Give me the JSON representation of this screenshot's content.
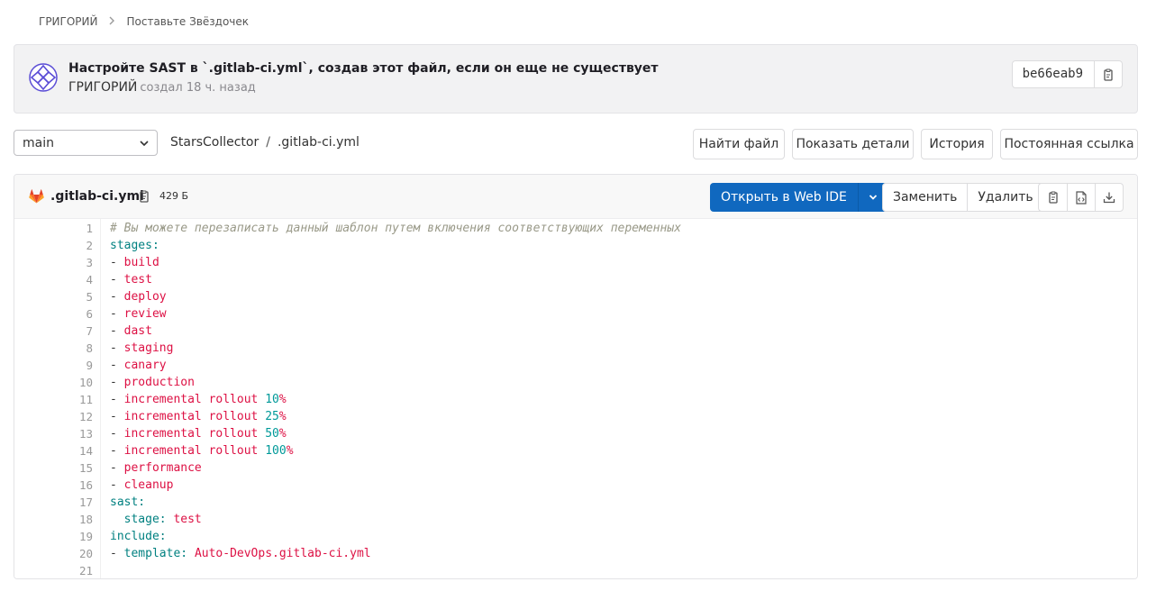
{
  "breadcrumb": {
    "items": [
      "ГРИГОРИЙ",
      "Поставьте Звёздочек"
    ]
  },
  "commit": {
    "title": "Настройте SAST в `.gitlab-ci.yml`, создав этот файл, если он еще не существует",
    "author": "ГРИГОРИЙ",
    "time": "создал 18 ч. назад",
    "sha": "be66eab9"
  },
  "toolbar": {
    "branch": "main",
    "project": "StarsCollector",
    "separator": "/",
    "file_path": ".gitlab-ci.yml",
    "find_file": "Найти файл",
    "show_details": "Показать детали",
    "history": "История",
    "permalink": "Постоянная ссылка"
  },
  "file": {
    "name": ".gitlab-ci.yml",
    "size": "429 Б",
    "open_web_ide": "Открыть в Web IDE",
    "replace": "Заменить",
    "delete": "Удалить"
  },
  "code_lines": [
    [
      [
        "c",
        "# Вы можете перезаписать данный шаблон путем включения соответствующих переменных"
      ]
    ],
    [
      [
        "k",
        "stages:"
      ]
    ],
    [
      [
        "d",
        "- "
      ],
      [
        "s",
        "build"
      ]
    ],
    [
      [
        "d",
        "- "
      ],
      [
        "s",
        "test"
      ]
    ],
    [
      [
        "d",
        "- "
      ],
      [
        "s",
        "deploy"
      ]
    ],
    [
      [
        "d",
        "- "
      ],
      [
        "s",
        "review"
      ]
    ],
    [
      [
        "d",
        "- "
      ],
      [
        "s",
        "dast"
      ]
    ],
    [
      [
        "d",
        "- "
      ],
      [
        "s",
        "staging"
      ]
    ],
    [
      [
        "d",
        "- "
      ],
      [
        "s",
        "canary"
      ]
    ],
    [
      [
        "d",
        "- "
      ],
      [
        "s",
        "production"
      ]
    ],
    [
      [
        "d",
        "- "
      ],
      [
        "s",
        "incremental rollout "
      ],
      [
        "n",
        "10"
      ],
      [
        "s",
        "%"
      ]
    ],
    [
      [
        "d",
        "- "
      ],
      [
        "s",
        "incremental rollout "
      ],
      [
        "n",
        "25"
      ],
      [
        "s",
        "%"
      ]
    ],
    [
      [
        "d",
        "- "
      ],
      [
        "s",
        "incremental rollout "
      ],
      [
        "n",
        "50"
      ],
      [
        "s",
        "%"
      ]
    ],
    [
      [
        "d",
        "- "
      ],
      [
        "s",
        "incremental rollout "
      ],
      [
        "n",
        "100"
      ],
      [
        "s",
        "%"
      ]
    ],
    [
      [
        "d",
        "- "
      ],
      [
        "s",
        "performance"
      ]
    ],
    [
      [
        "d",
        "- "
      ],
      [
        "s",
        "cleanup"
      ]
    ],
    [
      [
        "k",
        "sast:"
      ]
    ],
    [
      [
        "d",
        "  "
      ],
      [
        "k",
        "stage:"
      ],
      [
        "d",
        " "
      ],
      [
        "s",
        "test"
      ]
    ],
    [
      [
        "k",
        "include:"
      ]
    ],
    [
      [
        "d",
        "- "
      ],
      [
        "k",
        "template:"
      ],
      [
        "d",
        " "
      ],
      [
        "s",
        "Auto-DevOps.gitlab-ci.yml"
      ]
    ],
    []
  ],
  "icons": {
    "breadcrumb_sep": "chevron-right-icon",
    "avatar": "identicon-avatar",
    "copy": "copy-to-clipboard-icon",
    "branch_dropdown": "chevron-down-icon",
    "file_type": "gitlab-logo-icon",
    "web_ide_dropdown": "chevron-down-icon",
    "raw": "file-code-icon",
    "download": "download-icon"
  },
  "colors": {
    "primary": "#1068bf",
    "comment": "#999988",
    "key": "#008080",
    "string": "#dd1144",
    "number": "#009999"
  }
}
